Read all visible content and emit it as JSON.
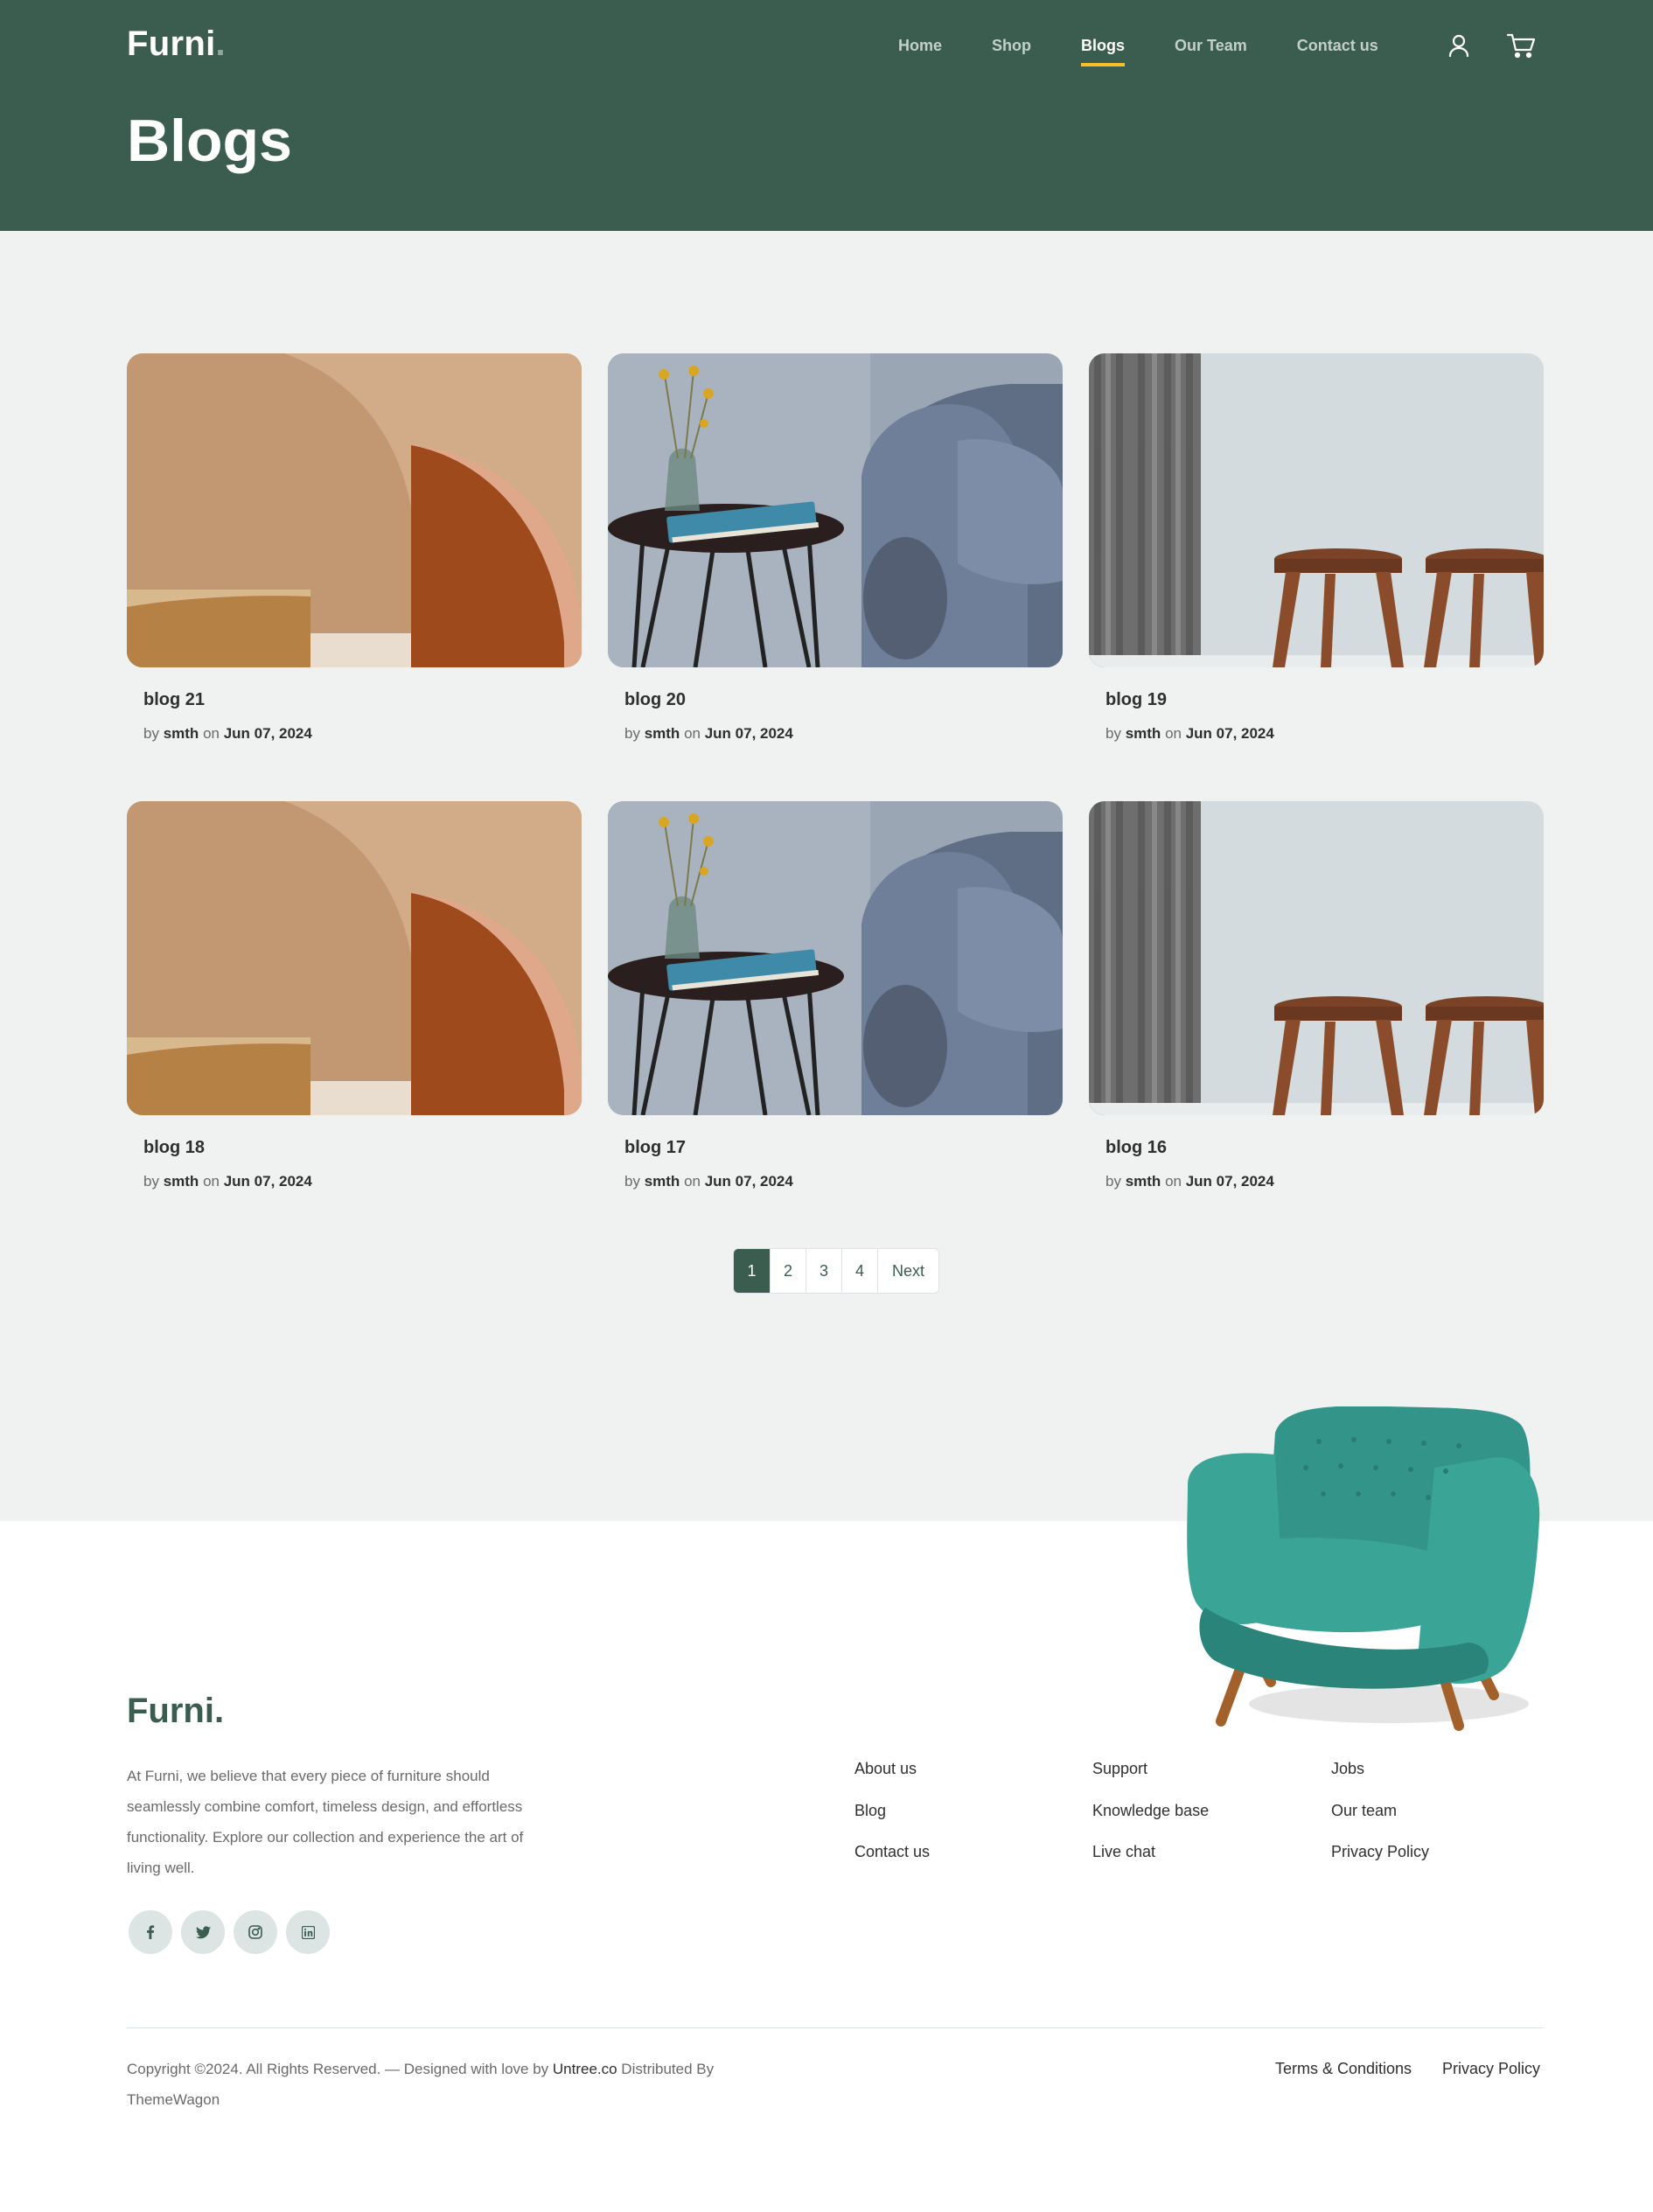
{
  "header": {
    "brand": "Furni",
    "brand_dot": ".",
    "nav": [
      {
        "label": "Home"
      },
      {
        "label": "Shop"
      },
      {
        "label": "Blogs",
        "active": true
      },
      {
        "label": "Our Team"
      },
      {
        "label": "Contact us"
      }
    ],
    "icons": [
      "user-icon",
      "cart-icon"
    ],
    "page_title": "Blogs"
  },
  "blogs": [
    {
      "title": "blog 21",
      "by": "by",
      "author": "smth",
      "on": "on",
      "date": "Jun 07, 2024",
      "image": "abstract-wood-shapes"
    },
    {
      "title": "blog 20",
      "by": "by",
      "author": "smth",
      "on": "on",
      "date": "Jun 07, 2024",
      "image": "side-table-and-sofa"
    },
    {
      "title": "blog 19",
      "by": "by",
      "author": "smth",
      "on": "on",
      "date": "Jun 07, 2024",
      "image": "wooden-stools-and-curtain"
    },
    {
      "title": "blog 18",
      "by": "by",
      "author": "smth",
      "on": "on",
      "date": "Jun 07, 2024",
      "image": "abstract-wood-shapes"
    },
    {
      "title": "blog 17",
      "by": "by",
      "author": "smth",
      "on": "on",
      "date": "Jun 07, 2024",
      "image": "side-table-and-sofa"
    },
    {
      "title": "blog 16",
      "by": "by",
      "author": "smth",
      "on": "on",
      "date": "Jun 07, 2024",
      "image": "wooden-stools-and-curtain"
    }
  ],
  "pagination": {
    "pages": [
      "1",
      "2",
      "3",
      "4"
    ],
    "current": "1",
    "next_label": "Next"
  },
  "footer": {
    "brand": "Furni.",
    "description": "At Furni, we believe that every piece of furniture should seamlessly combine comfort, timeless design, and effortless functionality. Explore our collection and experience the art of living well.",
    "socials": [
      "facebook-icon",
      "twitter-icon",
      "instagram-icon",
      "linkedin-icon"
    ],
    "links": {
      "col1": [
        "About us",
        "Blog",
        "Contact us"
      ],
      "col2": [
        "Support",
        "Knowledge base",
        "Live chat"
      ],
      "col3": [
        "Jobs",
        "Our team",
        "Privacy Policy"
      ]
    },
    "copyright_prefix": "Copyright ©2024. All Rights Reserved. — Designed with love by ",
    "designer": "Untree.co",
    "distributed": " Distributed By ThemeWagon",
    "legal": [
      "Terms & Conditions",
      "Privacy Policy"
    ]
  },
  "colors": {
    "primary": "#3b5d50",
    "accent": "#f9bf29",
    "background": "#eff2f1",
    "chair": "#3aa497"
  }
}
